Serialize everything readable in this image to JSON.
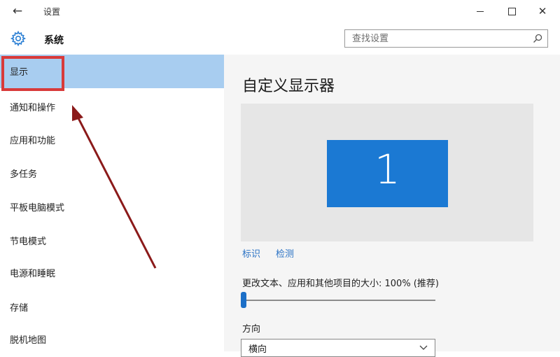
{
  "window": {
    "back_glyph": "←",
    "title": "设置",
    "minimize_icon": "minimize-icon",
    "maximize_icon": "maximize-icon",
    "close_glyph": "✕"
  },
  "header": {
    "section_title": "系统",
    "section_icon": "gear-icon",
    "search_placeholder": "查找设置",
    "search_icon": "search-icon"
  },
  "sidebar": {
    "selected_index": 0,
    "items": [
      {
        "label": "显示"
      },
      {
        "label": "通知和操作"
      },
      {
        "label": "应用和功能"
      },
      {
        "label": "多任务"
      },
      {
        "label": "平板电脑模式"
      },
      {
        "label": "节电模式"
      },
      {
        "label": "电源和睡眠"
      },
      {
        "label": "存储"
      },
      {
        "label": "脱机地图"
      }
    ]
  },
  "main": {
    "heading": "自定义显示器",
    "monitor_number": "1",
    "links": {
      "identify": "标识",
      "detect": "检测"
    },
    "scale_label": "更改文本、应用和其他项目的大小: 100% (推荐)",
    "scale_value_fraction": 0,
    "orientation_label": "方向",
    "orientation_value": "横向"
  },
  "colors": {
    "accent": "#1b79d3",
    "sidebar_selected": "#a8cdf0",
    "annotation_box": "#d83a3a",
    "annotation_arrow": "#8b1a1a",
    "link": "#2a72c4"
  }
}
